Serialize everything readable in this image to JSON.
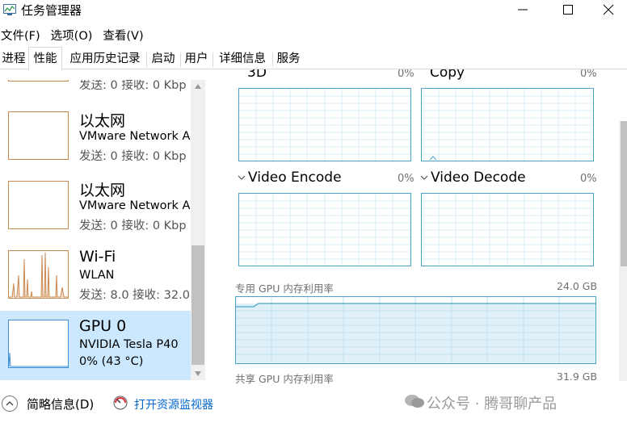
{
  "window": {
    "title": "任务管理器"
  },
  "menu": {
    "file": "文件(F)",
    "options": "选项(O)",
    "view": "查看(V)"
  },
  "tabs": [
    "进程",
    "性能",
    "应用历史记录",
    "启动",
    "用户",
    "详细信息",
    "服务"
  ],
  "sidebar": {
    "partial_top_stat": "发送: 0 接收: 0 Kbp",
    "items": [
      {
        "name": "以太网",
        "sub": "VMware Network A",
        "stat": "发送: 0 接收: 0 Kbp"
      },
      {
        "name": "以太网",
        "sub": "VMware Network A",
        "stat": "发送: 0 接收: 0 Kbp"
      },
      {
        "name": "Wi-Fi",
        "sub": "WLAN",
        "stat": "发送: 8.0 接收: 32.0"
      },
      {
        "name": "GPU 0",
        "sub": "NVIDIA Tesla P40",
        "stat": "0% (43 °C)"
      }
    ]
  },
  "gpu_panel": {
    "engines": [
      {
        "label": "3D",
        "pct": "0%"
      },
      {
        "label": "Copy",
        "pct": "0%"
      },
      {
        "label": "Video Encode",
        "pct": "0%"
      },
      {
        "label": "Video Decode",
        "pct": "0%"
      }
    ],
    "dedicated_label": "专用 GPU 内存利用率",
    "dedicated_value": "24.0 GB",
    "shared_label": "共享 GPU 内存利用率",
    "shared_value": "31.9 GB"
  },
  "footer": {
    "fewer_details": "简略信息(D)",
    "open_resmon": "打开资源监视器",
    "watermark": "公众号 · 腾哥聊产品"
  },
  "colors": {
    "accent": "#4aa2c6",
    "selected": "#cce8ff",
    "link": "#0066cc",
    "network": "#c8894f"
  }
}
